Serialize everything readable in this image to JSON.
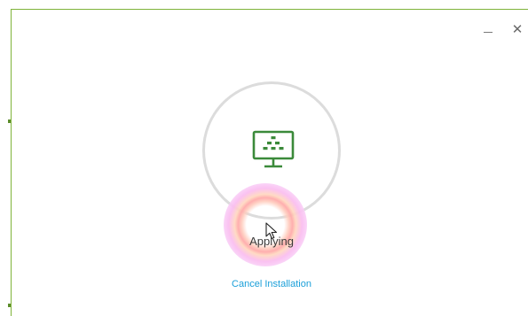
{
  "window": {
    "minimize_icon": "minimize-icon",
    "close_icon": "close-icon",
    "close_glyph": "✕"
  },
  "installer": {
    "app_icon": "monitor-icon",
    "status": "Applying",
    "cancel_label": "Cancel Installation"
  },
  "colors": {
    "icon_green": "#3b8a3a",
    "link_blue": "#1a9fd9",
    "ring_gray": "#dcdcdc",
    "frame_green": "#7fb33a"
  }
}
